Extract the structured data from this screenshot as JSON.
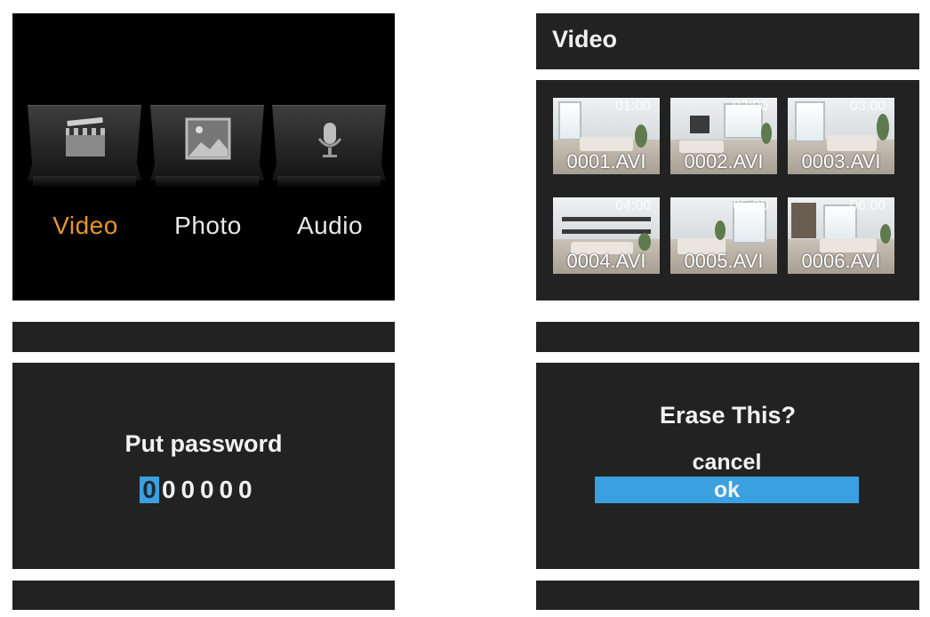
{
  "menu": {
    "items": [
      {
        "label": "Video",
        "icon": "clapperboard-icon",
        "active": true
      },
      {
        "label": "Photo",
        "icon": "picture-icon",
        "active": false
      },
      {
        "label": "Audio",
        "icon": "microphone-icon",
        "active": false
      }
    ],
    "active_color": "#e7962a"
  },
  "video_list": {
    "title": "Video",
    "thumbnails": [
      {
        "time": "01:00",
        "file": "0001.AVI"
      },
      {
        "time": "02:00",
        "file": "0002.AVI"
      },
      {
        "time": "03:00",
        "file": "0003.AVI"
      },
      {
        "time": "04:00",
        "file": "0004.AVI"
      },
      {
        "time": "05:00",
        "file": "0005.AVI"
      },
      {
        "time": "06:00",
        "file": "0006.AVI"
      }
    ]
  },
  "password_dialog": {
    "prompt": "Put password",
    "digits": [
      "0",
      "0",
      "0",
      "0",
      "0",
      "0"
    ],
    "selected_digit": 0,
    "highlight_color": "#3aa0e0"
  },
  "erase_dialog": {
    "question": "Erase This?",
    "options": [
      "cancel",
      "ok"
    ],
    "selected_option": "ok"
  }
}
